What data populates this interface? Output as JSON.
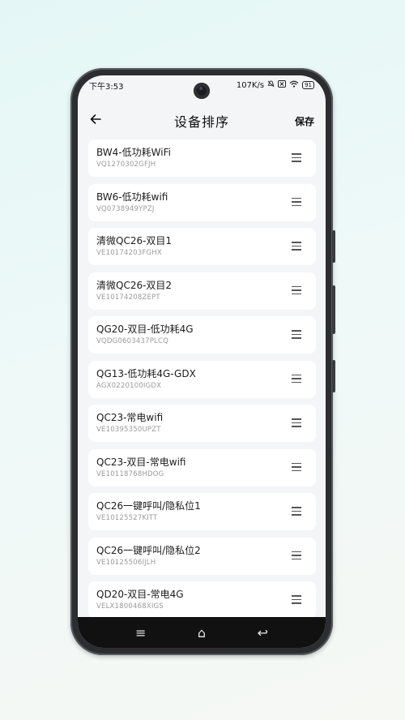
{
  "status": {
    "time": "下午3:53",
    "speed": "107K/s",
    "battery": "91"
  },
  "header": {
    "back_icon": "arrow-left-icon",
    "title": "设备排序",
    "save_label": "保存"
  },
  "devices": [
    {
      "name": "BW4-低功耗WiFi",
      "code": "VQ1270302GFJH"
    },
    {
      "name": "BW6-低功耗wifi",
      "code": "VQ0738949YPZJ"
    },
    {
      "name": "清微QC26-双目1",
      "code": "VE10174203FGHX"
    },
    {
      "name": "清微QC26-双目2",
      "code": "VE10174208ZEPT"
    },
    {
      "name": "QG20-双目-低功耗4G",
      "code": "VQDG0603437PLCQ"
    },
    {
      "name": "QG13-低功耗4G-GDX",
      "code": "AGX0220100IGDX"
    },
    {
      "name": "QC23-常电wifi",
      "code": "VE10395350UPZT"
    },
    {
      "name": "QC23-双目-常电wifi",
      "code": "VE10118768HDOG"
    },
    {
      "name": "QC26一键呼叫/隐私位1",
      "code": "VE10125527KITT"
    },
    {
      "name": "QC26一键呼叫/隐私位2",
      "code": "VE10125506IJLH"
    },
    {
      "name": "QD20-双目-常电4G",
      "code": "VELX1800468XIGS"
    }
  ],
  "navbar": {
    "menu_icon": "≡",
    "home_icon": "⌂",
    "back_icon": "↩"
  }
}
